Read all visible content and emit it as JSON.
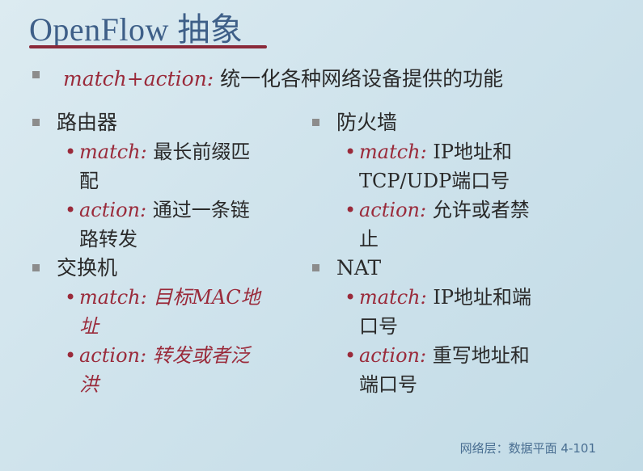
{
  "title": "OpenFlow 抽象",
  "intro": {
    "term": "match+action:",
    "text": " 统一化各种网络设备提供的功能"
  },
  "left": [
    {
      "label": "路由器",
      "subs": [
        {
          "term": "match:",
          "lines": [
            " 最长前缀匹",
            "配"
          ]
        },
        {
          "term": "action:",
          "lines": [
            " 通过一条链",
            "路转发"
          ]
        }
      ]
    },
    {
      "label": "交换机",
      "subs": [
        {
          "term": "match:",
          "lines": [
            " 目标MAC地",
            "址"
          ]
        },
        {
          "term": "action:",
          "lines": [
            " 转发或者泛",
            "洪"
          ]
        }
      ]
    }
  ],
  "right": [
    {
      "label": "防火墙",
      "subs": [
        {
          "term": "match:",
          "lines": [
            " IP地址和",
            "TCP/UDP端口号"
          ]
        },
        {
          "term": "action:",
          "lines": [
            " 允许或者禁",
            "止"
          ]
        }
      ]
    },
    {
      "label": "NAT",
      "subs": [
        {
          "term": "match:",
          "lines": [
            " IP地址和端",
            "口号"
          ]
        },
        {
          "term": "action:",
          "lines": [
            " 重写地址和",
            "端口号"
          ]
        }
      ]
    }
  ],
  "footer": "网络层：数据平面 4-101"
}
